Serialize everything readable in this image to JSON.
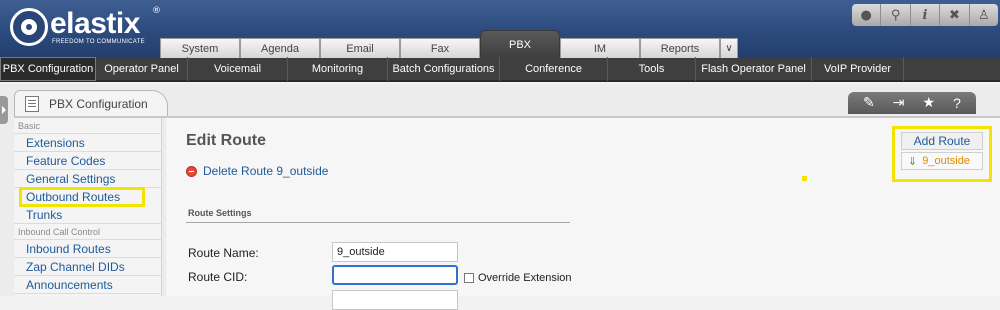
{
  "app": {
    "logo_text": "elastix",
    "logo_tagline": "FREEDOM TO COMMUNICATE",
    "logo_registered": "®"
  },
  "top_icons": [
    "drop-icon",
    "search-icon",
    "info-icon",
    "tools-icon",
    "user-icon"
  ],
  "tabs": [
    "System",
    "Agenda",
    "Email",
    "Fax",
    "PBX",
    "IM",
    "Reports"
  ],
  "active_tab": "PBX",
  "subnav": [
    "PBX Configuration",
    "Operator Panel",
    "Voicemail",
    "Monitoring",
    "Batch Configurations",
    "Conference",
    "Tools",
    "Flash Operator Panel",
    "VoIP Provider"
  ],
  "page_tab": {
    "label": "PBX Configuration"
  },
  "sidebar": {
    "sections": [
      {
        "heading": "Basic",
        "items": [
          "Extensions",
          "Feature Codes",
          "General Settings",
          "Outbound Routes",
          "Trunks"
        ]
      },
      {
        "heading": "Inbound Call Control",
        "items": [
          "Inbound Routes",
          "Zap Channel DIDs",
          "Announcements"
        ]
      }
    ],
    "highlighted": "Outbound Routes"
  },
  "main": {
    "title": "Edit Route",
    "delete_link": "Delete Route 9_outside",
    "section_title": "Route Settings",
    "fields": {
      "route_name_label": "Route Name:",
      "route_name_value": "9_outside",
      "route_cid_label": "Route CID:",
      "route_cid_value": "",
      "override_label": "Override Extension"
    }
  },
  "routes_box": {
    "add_label": "Add Route",
    "items": [
      {
        "label": "9_outside"
      }
    ]
  }
}
